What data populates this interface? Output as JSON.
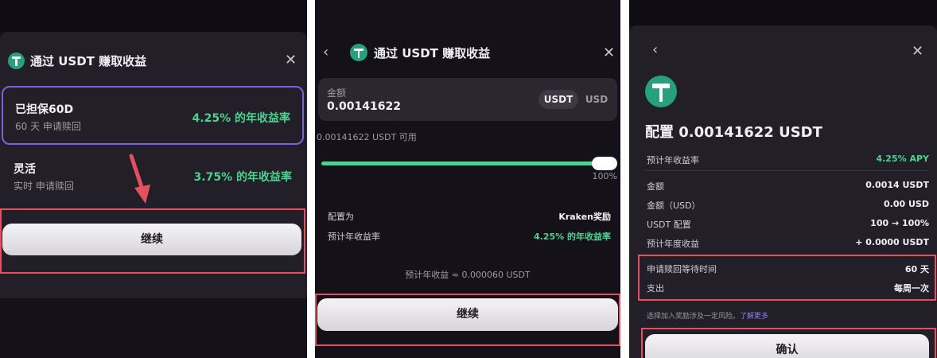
{
  "panel1": {
    "title": "通过 USDT 赚取收益",
    "options": [
      {
        "name": "已担保60D",
        "sub": "60 天 申请赎回",
        "rate": "4.25% 的年收益率"
      },
      {
        "name": "灵活",
        "sub": "实时 申请赎回",
        "rate": "3.75% 的年收益率"
      }
    ],
    "continue_label": "继续"
  },
  "panel2": {
    "title": "通过 USDT 赚取收益",
    "amount_label": "金额",
    "amount_value": "0.00141622",
    "currency_options": [
      "USDT",
      "USD"
    ],
    "selected_currency": "USDT",
    "available": "0.00141622 USDT 可用",
    "slider_value_percent": 100,
    "slider_label": "100%",
    "allocate_label": "配置为",
    "allocate_value": "Kraken奖励",
    "apr_label": "预计年收益率",
    "apr_value": "4.25% 的年收益率",
    "estimate": "预计年收益 ≈ 0.000060 USDT",
    "continue_label": "继续"
  },
  "panel3": {
    "title": "配置 0.00141622 USDT",
    "apy_label": "预计年收益率",
    "apy_value": "4.25% APY",
    "rows": [
      {
        "label": "金额",
        "value": "0.0014 USDT"
      },
      {
        "label": "金额（USD）",
        "value": "0.00 USD"
      },
      {
        "label": "USDT 配置",
        "value": "100 → 100%"
      },
      {
        "label": "预计年度收益",
        "value": "+ 0.0000 USDT"
      }
    ],
    "highlight_rows": [
      {
        "label": "申请赎回等待时间",
        "value": "60 天"
      },
      {
        "label": "支出",
        "value": "每周一次"
      }
    ],
    "risk_note": "选择加入奖励涉及一定风险。",
    "learn_more": "了解更多",
    "confirm_label": "确认"
  },
  "colors": {
    "background": "#141119",
    "accent_green": "#4ad38d",
    "highlight_red": "#e4505e",
    "selected_border": "#7d62d9",
    "link": "#8f7cf0"
  },
  "icons": [
    "tether-icon",
    "close-icon",
    "chevron-left-icon",
    "arrow-annotation-icon"
  ]
}
